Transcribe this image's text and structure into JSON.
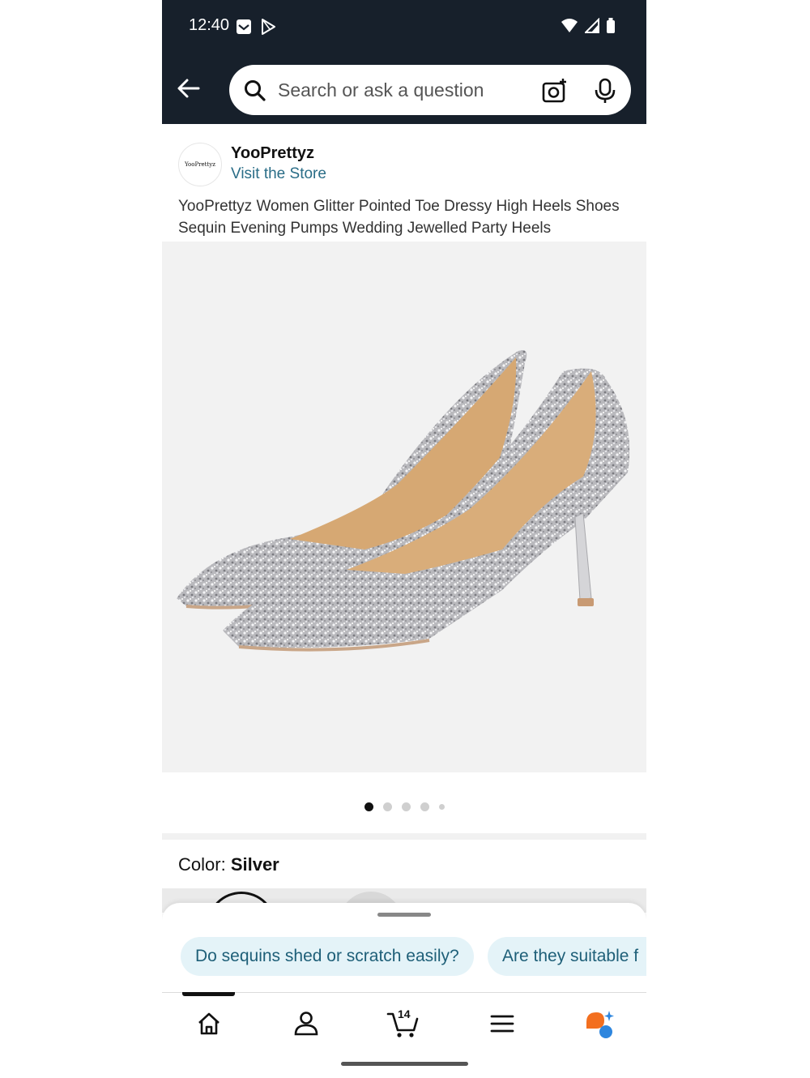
{
  "status": {
    "time": "12:40"
  },
  "search": {
    "placeholder": "Search or ask a question"
  },
  "brand": {
    "logo_text": "YooPrettyz",
    "name": "YooPrettyz",
    "visit_label": "Visit the Store"
  },
  "product": {
    "title": "YooPrettyz Women Glitter Pointed Toe Dressy High Heels Shoes Sequin Evening Pumps Wedding Jewelled Party Heels",
    "image_count": 5,
    "active_image": 1,
    "color_label": "Color:",
    "color_value": "Silver"
  },
  "suggestions": [
    "Do sequins shed or scratch easily?",
    "Are they suitable f"
  ],
  "nav": {
    "cart_count": "14"
  },
  "colors": {
    "header_bg": "#17202b",
    "chip_bg": "#e4f3f8",
    "link": "#2a6d87",
    "ai_orange": "#f36f1f",
    "ai_blue": "#2e86de"
  }
}
